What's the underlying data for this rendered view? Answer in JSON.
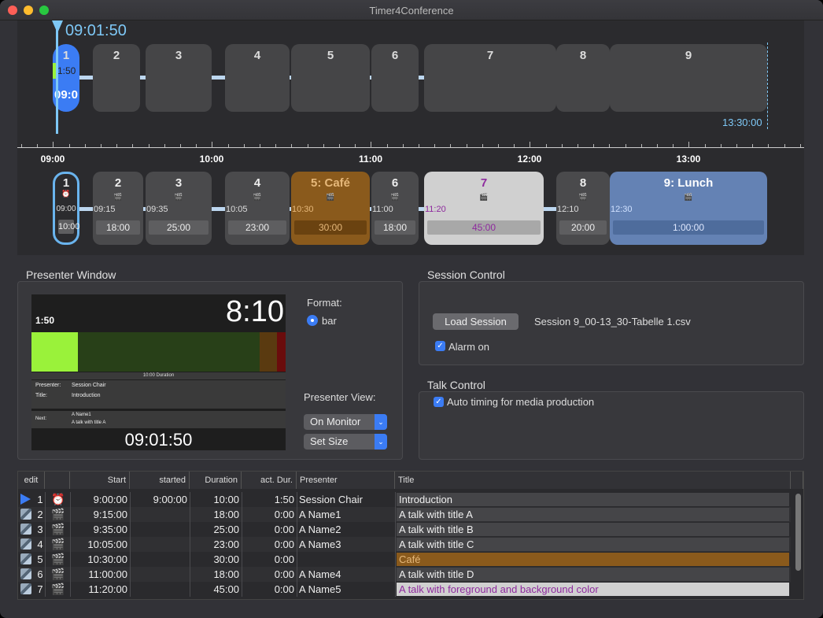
{
  "window": {
    "title": "Timer4Conference",
    "traffic_lights": {
      "close": "#fe5f57",
      "minimize": "#febc2e",
      "zoom": "#28c840"
    }
  },
  "timeline_top": {
    "current_time": "09:01:50",
    "end_time": "13:30:00",
    "blocks": [
      {
        "num": "1",
        "timer": "1:50",
        "clock": "09:0"
      },
      {
        "num": "2"
      },
      {
        "num": "3"
      },
      {
        "num": "4"
      },
      {
        "num": "5"
      },
      {
        "num": "6"
      },
      {
        "num": "7"
      },
      {
        "num": "8"
      },
      {
        "num": "9"
      }
    ]
  },
  "ruler": {
    "hours": [
      "09:00",
      "10:00",
      "11:00",
      "12:00",
      "13:00"
    ]
  },
  "timeline_bottom": {
    "blocks": [
      {
        "num": "1",
        "icon": "alarm-clock-icon",
        "start": "09:00",
        "dur": "10:00"
      },
      {
        "num": "2",
        "icon": "clapperboard-icon",
        "start": "09:15",
        "dur": "18:00"
      },
      {
        "num": "3",
        "icon": "clapperboard-icon",
        "start": "09:35",
        "dur": "25:00"
      },
      {
        "num": "4",
        "icon": "clapperboard-icon",
        "start": "10:05",
        "dur": "23:00"
      },
      {
        "num": "5: Café",
        "icon": "clapperboard-icon",
        "start": "10:30",
        "dur": "30:00"
      },
      {
        "num": "6",
        "icon": "clapperboard-icon",
        "start": "11:00",
        "dur": "18:00"
      },
      {
        "num": "7",
        "icon": "clapperboard-icon",
        "start": "11:20",
        "dur": "45:00"
      },
      {
        "num": "8",
        "icon": "clapperboard-icon",
        "start": "12:10",
        "dur": "20:00"
      },
      {
        "num": "9: Lunch",
        "icon": "clapperboard-icon",
        "start": "12:30",
        "dur": "1:00:00"
      }
    ]
  },
  "presenter": {
    "section_label": "Presenter Window",
    "elapsed": "1:50",
    "remaining": "8:10",
    "bar_caption": "10:00  Duration",
    "presenter_label": "Presenter:",
    "presenter_value": "Session Chair",
    "title_label": "Title:",
    "title_value": "Introduction",
    "next_label": "Next:",
    "next_name": "A Name1",
    "next_title": "A talk with title A",
    "clock": "09:01:50",
    "format_label": "Format:",
    "format_option": "bar",
    "view_label": "Presenter View:",
    "view_select": "On Monitor",
    "size_select": "Set Size",
    "bar_progress": 0.183
  },
  "session": {
    "section_label": "Session Control",
    "load_button": "Load Session",
    "file": "Session 9_00-13_30-Tabelle 1.csv",
    "alarm_label": "Alarm on"
  },
  "talk": {
    "section_label": "Talk Control",
    "auto_label": "Auto timing for media production"
  },
  "table": {
    "headers": [
      "edit",
      "",
      "Start",
      "started",
      "Duration",
      "act. Dur.",
      "Presenter",
      "Title"
    ],
    "rows": [
      {
        "n": "1",
        "start": "9:00:00",
        "started": "9:00:00",
        "duration": "10:00",
        "act": "1:50",
        "presenter": "Session Chair",
        "title": "Introduction"
      },
      {
        "n": "2",
        "start": "9:15:00",
        "started": "",
        "duration": "18:00",
        "act": "0:00",
        "presenter": "A Name1",
        "title": "A talk with title A"
      },
      {
        "n": "3",
        "start": "9:35:00",
        "started": "",
        "duration": "25:00",
        "act": "0:00",
        "presenter": "A Name2",
        "title": "A talk with title B"
      },
      {
        "n": "4",
        "start": "10:05:00",
        "started": "",
        "duration": "23:00",
        "act": "0:00",
        "presenter": "A Name3",
        "title": "A talk with title C"
      },
      {
        "n": "5",
        "start": "10:30:00",
        "started": "",
        "duration": "30:00",
        "act": "0:00",
        "presenter": "",
        "title": "Café"
      },
      {
        "n": "6",
        "start": "11:00:00",
        "started": "",
        "duration": "18:00",
        "act": "0:00",
        "presenter": "A Name4",
        "title": "A talk with title D"
      },
      {
        "n": "7",
        "start": "11:20:00",
        "started": "",
        "duration": "45:00",
        "act": "0:00",
        "presenter": "A Name5",
        "title": "A talk with foreground and background color"
      }
    ]
  },
  "colors": {
    "accent": "#3b7cf4",
    "time_blue": "#7ec8f6",
    "cafe": "#8a5a1c",
    "lunch": "#6482b4",
    "talk7_bg": "#d0d0d0",
    "talk7_fg": "#8e2a9e",
    "bar_green": "#9af23a"
  }
}
